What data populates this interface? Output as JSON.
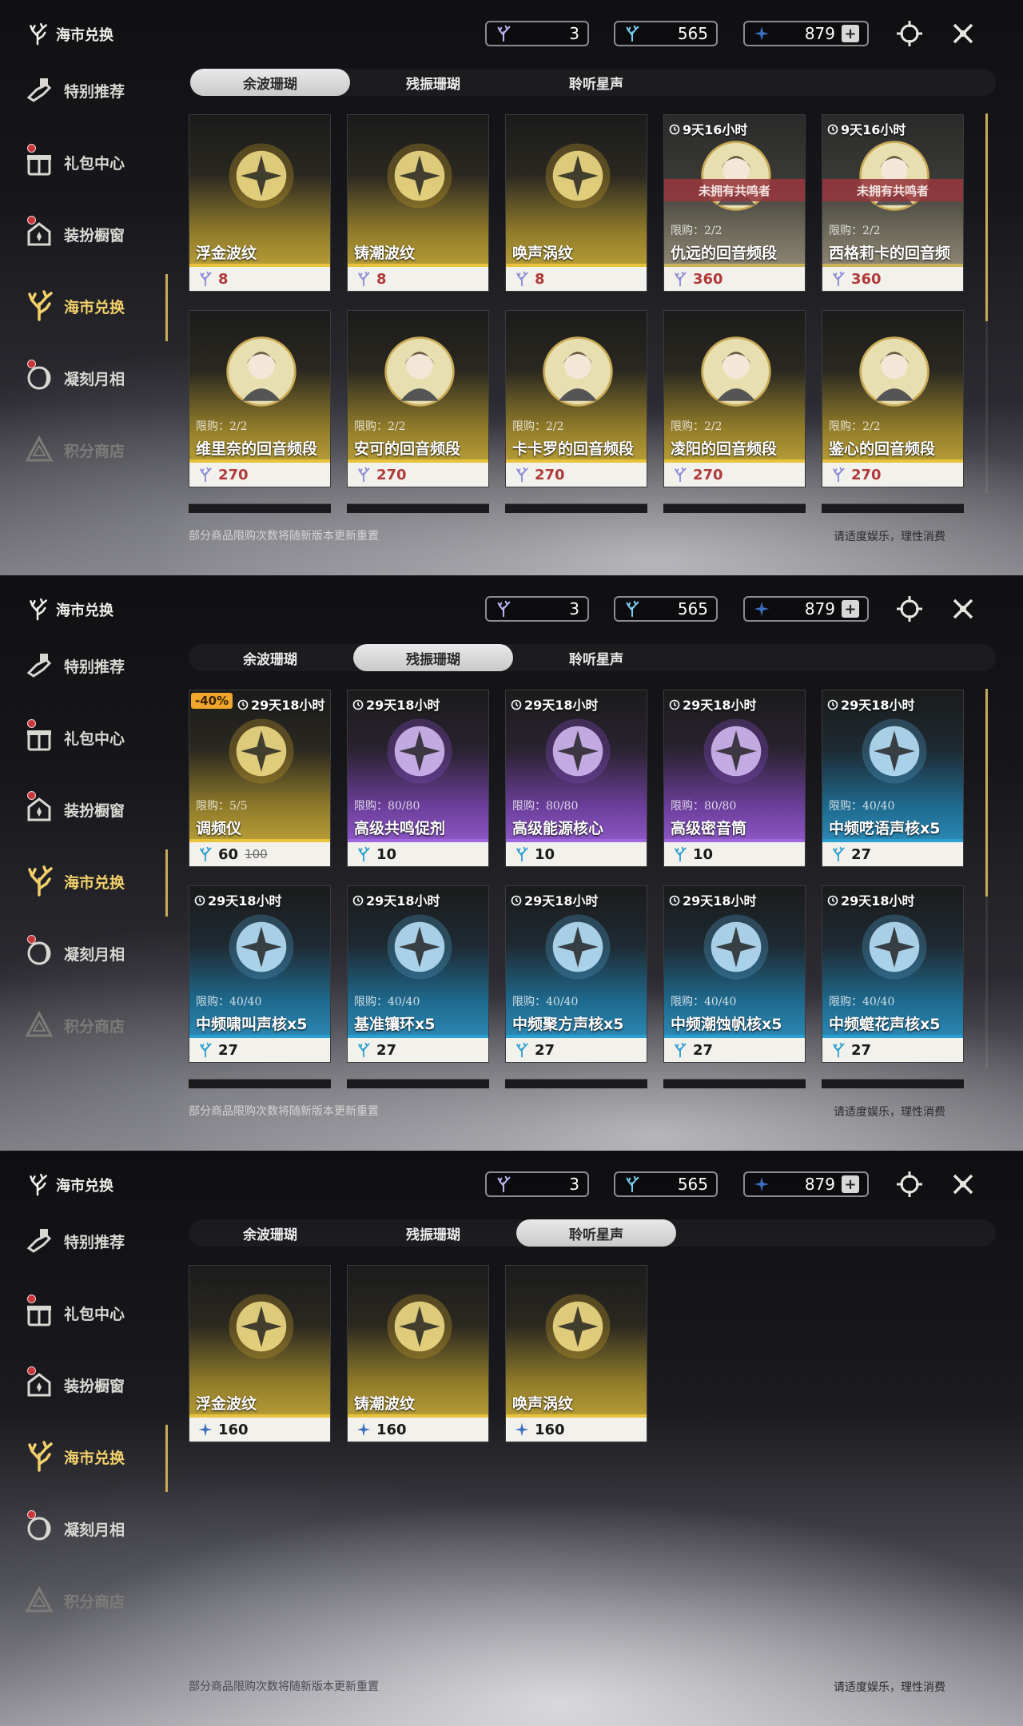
{
  "header": {
    "title": "海市兑换",
    "currencies": [
      {
        "icon": "coral-feather-icon",
        "value": "3"
      },
      {
        "icon": "coral-lyre-icon",
        "value": "565"
      },
      {
        "icon": "star-crystal-icon",
        "value": "879"
      }
    ],
    "add_symbol": "+"
  },
  "sidebar": {
    "items": [
      {
        "label": "特别推荐",
        "icon": "recommend-icon"
      },
      {
        "label": "礼包中心",
        "icon": "gift-icon"
      },
      {
        "label": "装扮橱窗",
        "icon": "outfit-icon"
      },
      {
        "label": "海市兑换",
        "icon": "coral-exchange-icon"
      },
      {
        "label": "凝刻月相",
        "icon": "moon-phase-icon"
      },
      {
        "label": "积分商店",
        "icon": "points-shop-icon"
      }
    ]
  },
  "tabs": [
    "余波珊瑚",
    "残振珊瑚",
    "聆听星声"
  ],
  "footer": {
    "notice": "部分商品限购次数将随新版本更新重置",
    "healthy": "请适度娱乐，理性消费"
  },
  "colors": {
    "accent_gold": "#f2d16b",
    "price_red": "#b03a3a",
    "tag_orange": "#f0a52c"
  },
  "panel1": {
    "active_tab": 0,
    "cards": [
      {
        "name": "浮金波纹",
        "price": "8",
        "theme": "gold",
        "currency": "afterglow-coral-icon"
      },
      {
        "name": "铸潮波纹",
        "price": "8",
        "theme": "gold",
        "currency": "afterglow-coral-icon"
      },
      {
        "name": "唤声涡纹",
        "price": "8",
        "theme": "gold",
        "currency": "afterglow-coral-icon"
      },
      {
        "name": "仇远的回音频段",
        "price": "360",
        "theme": "grey",
        "timer": "9天16小时",
        "limit": "限购：2/2",
        "badge": "未拥有共鸣者",
        "currency": "afterglow-coral-icon"
      },
      {
        "name": "西格莉卡的回音频段",
        "price": "360",
        "theme": "grey",
        "timer": "9天16小时",
        "limit": "限购：2/2",
        "badge": "未拥有共鸣者",
        "currency": "afterglow-coral-icon"
      },
      {
        "name": "维里奈的回音频段",
        "price": "270",
        "theme": "gold",
        "limit": "限购：2/2",
        "currency": "afterglow-coral-icon"
      },
      {
        "name": "安可的回音频段",
        "price": "270",
        "theme": "gold",
        "limit": "限购：2/2",
        "currency": "afterglow-coral-icon"
      },
      {
        "name": "卡卡罗的回音频段",
        "price": "270",
        "theme": "gold",
        "limit": "限购：2/2",
        "currency": "afterglow-coral-icon"
      },
      {
        "name": "凌阳的回音频段",
        "price": "270",
        "theme": "gold",
        "limit": "限购：2/2",
        "currency": "afterglow-coral-icon"
      },
      {
        "name": "鉴心的回音频段",
        "price": "270",
        "theme": "gold",
        "limit": "限购：2/2",
        "currency": "afterglow-coral-icon"
      }
    ]
  },
  "panel2": {
    "active_tab": 1,
    "cards": [
      {
        "name": "调频仪",
        "price": "60",
        "old_price": "100",
        "discount": "-40%",
        "theme": "gold",
        "timer": "29天18小时",
        "limit": "限购：5/5",
        "currency": "oscillated-coral-icon"
      },
      {
        "name": "高级共鸣促剂",
        "price": "10",
        "theme": "purple",
        "timer": "29天18小时",
        "limit": "限购：80/80",
        "currency": "oscillated-coral-icon"
      },
      {
        "name": "高级能源核心",
        "price": "10",
        "theme": "purple",
        "timer": "29天18小时",
        "limit": "限购：80/80",
        "currency": "oscillated-coral-icon"
      },
      {
        "name": "高级密音筒",
        "price": "10",
        "theme": "purple",
        "timer": "29天18小时",
        "limit": "限购：80/80",
        "currency": "oscillated-coral-icon"
      },
      {
        "name": "中频呓语声核x5",
        "price": "27",
        "theme": "blue",
        "timer": "29天18小时",
        "limit": "限购：40/40",
        "currency": "oscillated-coral-icon"
      },
      {
        "name": "中频啸叫声核x5",
        "price": "27",
        "theme": "blue",
        "timer": "29天18小时",
        "limit": "限购：40/40",
        "currency": "oscillated-coral-icon"
      },
      {
        "name": "基准镶环x5",
        "price": "27",
        "theme": "blue",
        "timer": "29天18小时",
        "limit": "限购：40/40",
        "currency": "oscillated-coral-icon"
      },
      {
        "name": "中频聚方声核x5",
        "price": "27",
        "theme": "blue",
        "timer": "29天18小时",
        "limit": "限购：40/40",
        "currency": "oscillated-coral-icon"
      },
      {
        "name": "中频潮蚀帆核x5",
        "price": "27",
        "theme": "blue",
        "timer": "29天18小时",
        "limit": "限购：40/40",
        "currency": "oscillated-coral-icon"
      },
      {
        "name": "中频䗴花声核x5",
        "price": "27",
        "theme": "blue",
        "timer": "29天18小时",
        "limit": "限购：40/40",
        "currency": "oscillated-coral-icon"
      }
    ]
  },
  "panel3": {
    "active_tab": 2,
    "cards": [
      {
        "name": "浮金波纹",
        "price": "160",
        "theme": "gold",
        "currency": "star-crystal-icon"
      },
      {
        "name": "铸潮波纹",
        "price": "160",
        "theme": "gold",
        "currency": "star-crystal-icon"
      },
      {
        "name": "唤声涡纹",
        "price": "160",
        "theme": "gold",
        "currency": "star-crystal-icon"
      }
    ]
  }
}
